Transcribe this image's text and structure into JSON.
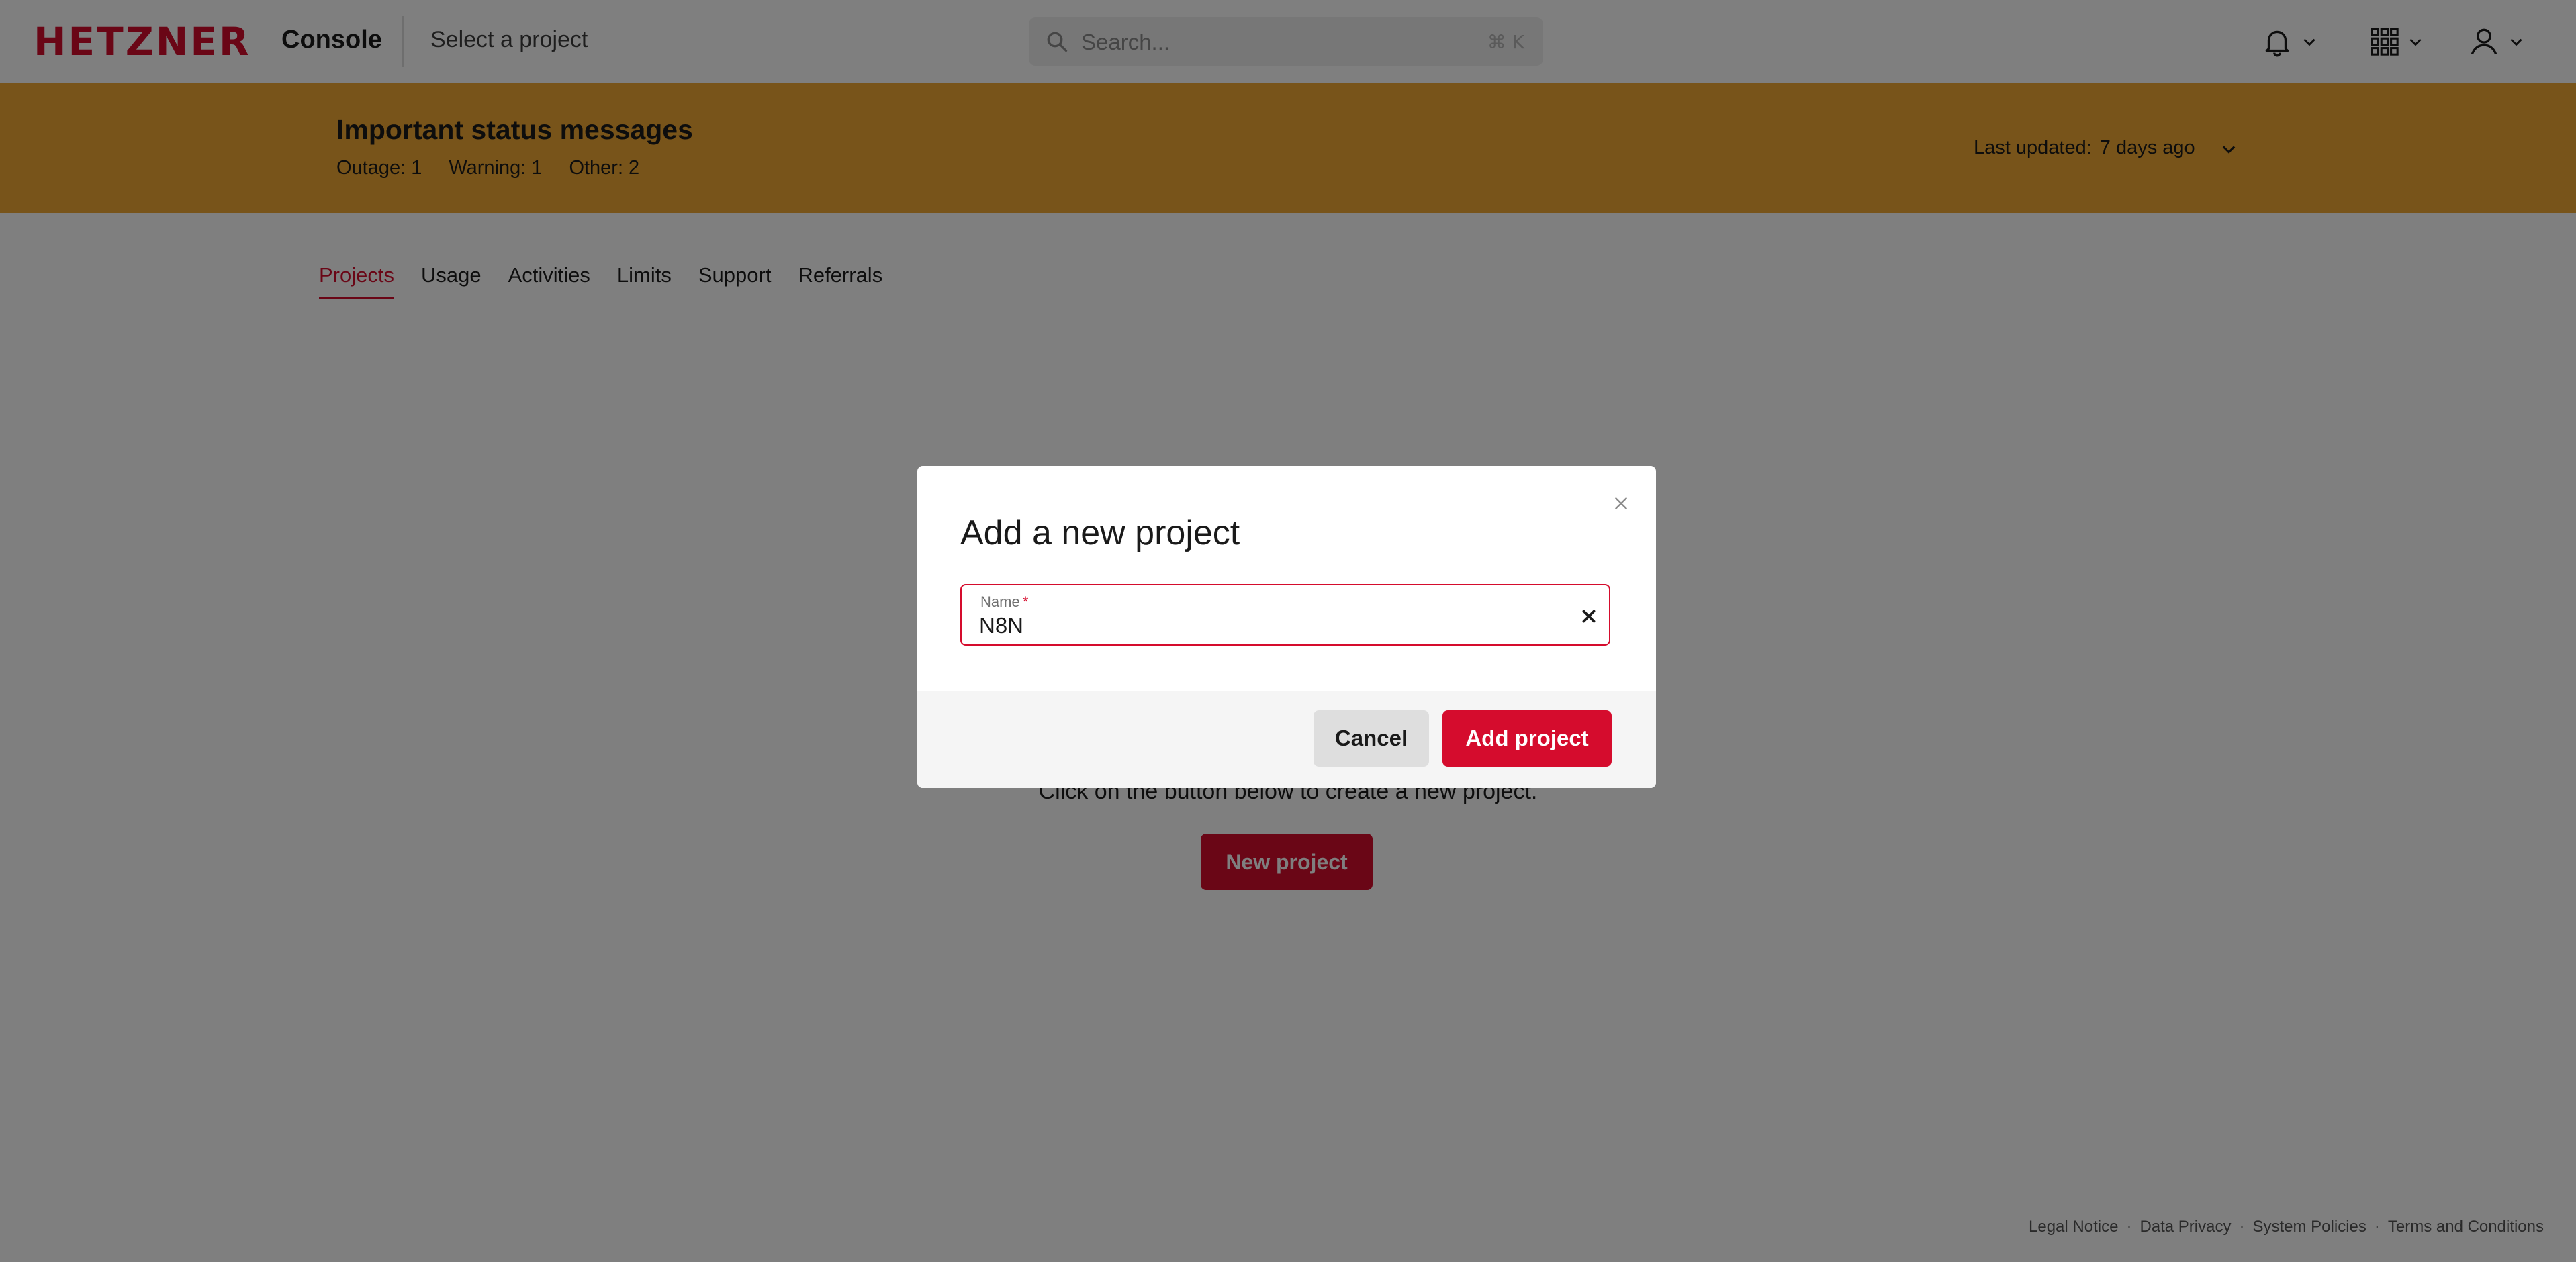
{
  "header": {
    "logo_text": "HETZNER",
    "app_name": "Console",
    "project_selector": "Select a project",
    "search_placeholder": "Search...",
    "search_shortcut": "⌘ K",
    "icons": [
      "bell-icon",
      "apps-grid-icon",
      "user-icon",
      "chevron-down-icon"
    ]
  },
  "status_banner": {
    "title": "Important status messages",
    "counts": [
      {
        "label": "Outage:",
        "value": "1"
      },
      {
        "label": "Warning:",
        "value": "1"
      },
      {
        "label": "Other:",
        "value": "2"
      }
    ],
    "last_updated_label": "Last updated:",
    "last_updated_value": "7 days ago",
    "color": "#f0a834"
  },
  "tabs": [
    {
      "label": "Projects",
      "active": true
    },
    {
      "label": "Usage",
      "active": false
    },
    {
      "label": "Activities",
      "active": false
    },
    {
      "label": "Limits",
      "active": false
    },
    {
      "label": "Support",
      "active": false
    },
    {
      "label": "Referrals",
      "active": false
    }
  ],
  "empty_state": {
    "text": "Click on the button below to create a new project.",
    "button_label": "New project"
  },
  "modal": {
    "title": "Add a new project",
    "field_label": "Name",
    "field_required_marker": "*",
    "field_value": "N8N",
    "cancel_label": "Cancel",
    "submit_label": "Add project"
  },
  "footer": {
    "links": [
      "Legal Notice",
      "Data Privacy",
      "System Policies",
      "Terms and Conditions"
    ],
    "separator": "·"
  },
  "colors": {
    "brand": "#d50c2d",
    "banner": "#f0a834",
    "overlay": "rgba(0,0,0,0.5)"
  }
}
